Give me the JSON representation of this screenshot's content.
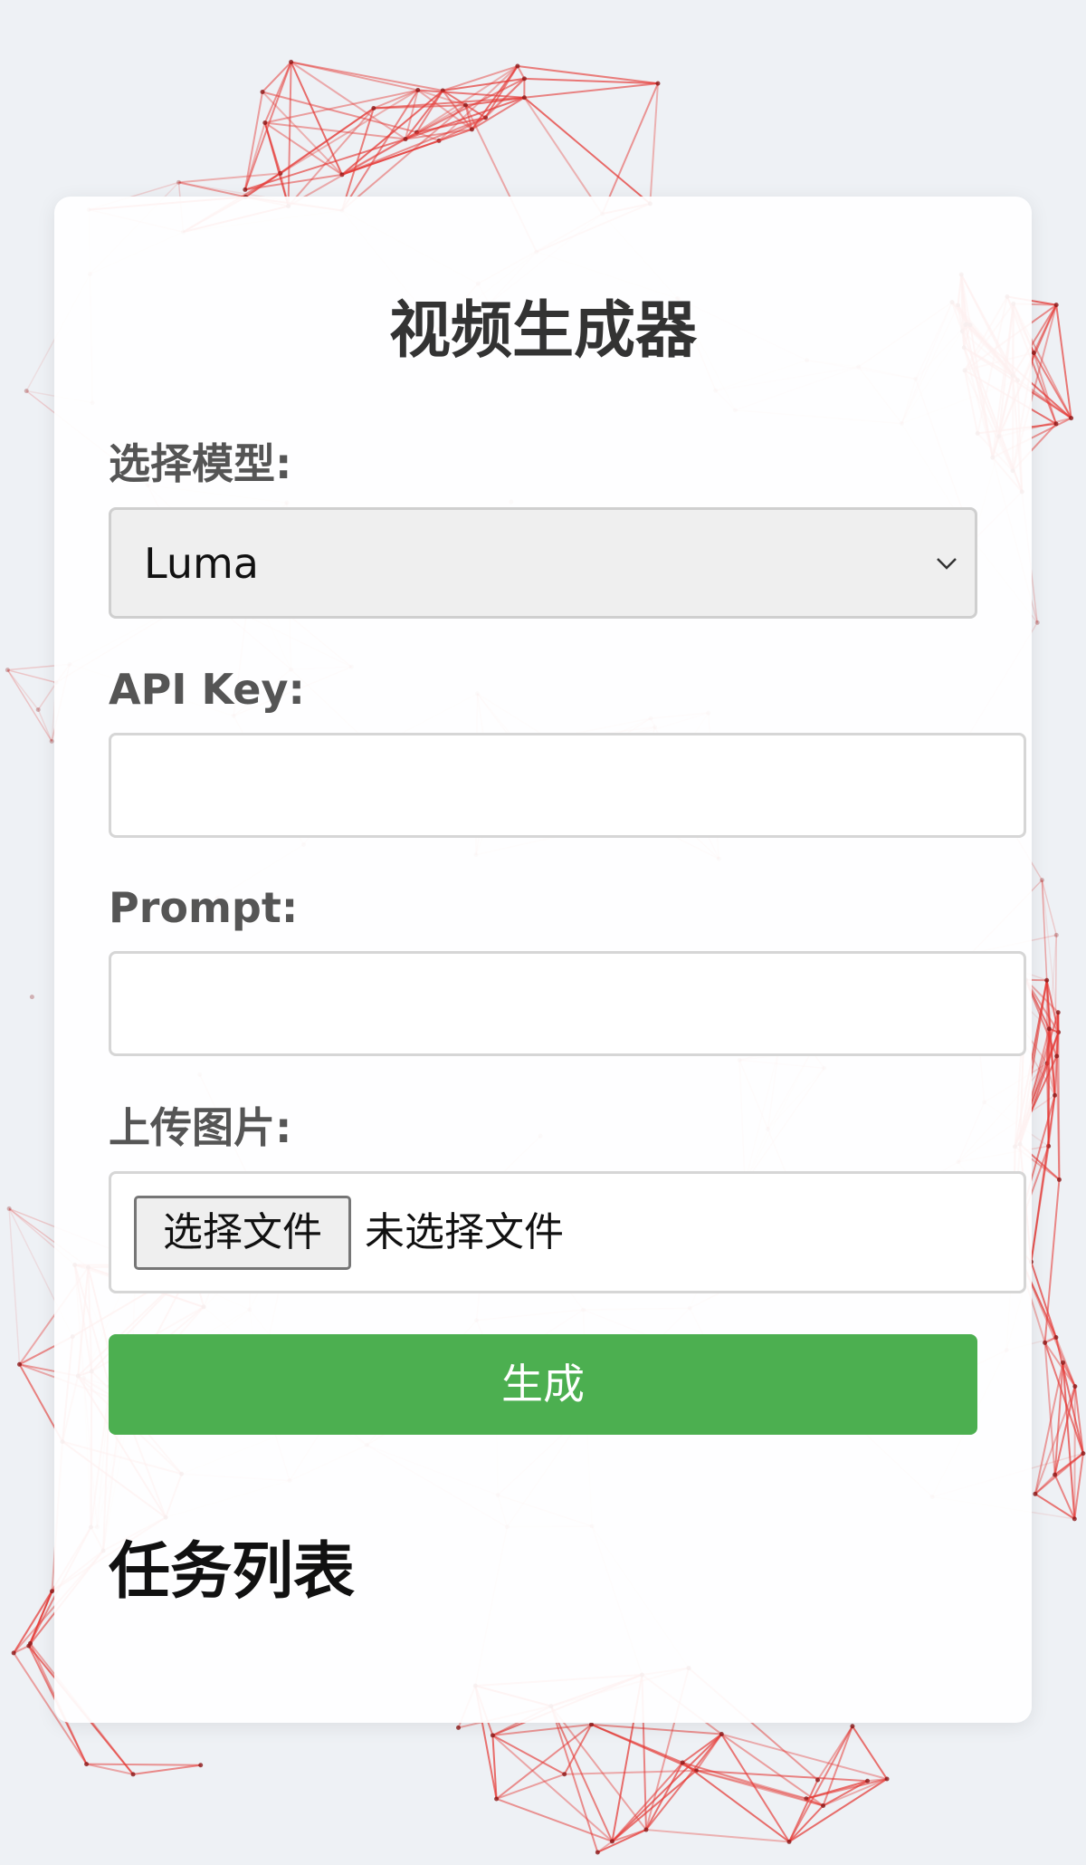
{
  "form": {
    "title": "视频生成器",
    "model_label": "选择模型:",
    "model_selected": "Luma",
    "api_key_label": "API Key:",
    "api_key_value": "",
    "prompt_label": "Prompt:",
    "prompt_value": "",
    "upload_label": "上传图片:",
    "file_button_label": "选择文件",
    "file_status": "未选择文件",
    "generate_label": "生成"
  },
  "tasks": {
    "title": "任务列表"
  },
  "colors": {
    "page_background": "#eef1f5",
    "card_background": "#ffffff",
    "accent_button": "#4caf50",
    "network_lines": "#e53935"
  },
  "icons": {
    "select_chevron": "chevron-down-icon"
  }
}
